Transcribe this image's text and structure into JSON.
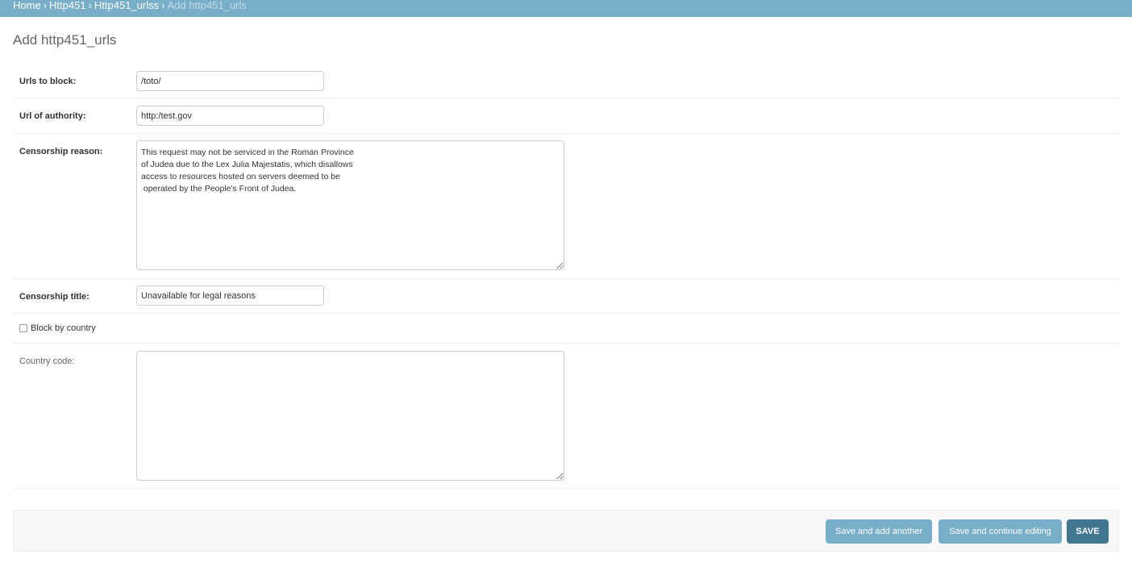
{
  "breadcrumbs": {
    "home": "Home",
    "app": "Http451",
    "model": "Http451_urlss",
    "current": "Add http451_urls",
    "separator": "›"
  },
  "page_title": "Add http451_urls",
  "form": {
    "urls_to_block": {
      "label": "Urls to block:",
      "value": "/toto/"
    },
    "url_of_authority": {
      "label": "Url of authority:",
      "value": "http:/test.gov"
    },
    "censorship_reason": {
      "label": "Censorship reason:",
      "value": "This request may not be serviced in the Roman Province\nof Judea due to the Lex Julia Majestatis, which disallows\naccess to resources hosted on servers deemed to be\n operated by the People's Front of Judea."
    },
    "censorship_title": {
      "label": "Censorship title:",
      "value": "Unavailable for legal reasons"
    },
    "block_by_country": {
      "label": "Block by country",
      "checked": false
    },
    "country_code": {
      "label": "Country code:",
      "value": ""
    }
  },
  "submit_row": {
    "save_add_another": "Save and add another",
    "save_continue": "Save and continue editing",
    "save": "SAVE"
  },
  "colors": {
    "header": "#79aec8",
    "primary_button": "#417690",
    "secondary_button": "#79aec8"
  }
}
